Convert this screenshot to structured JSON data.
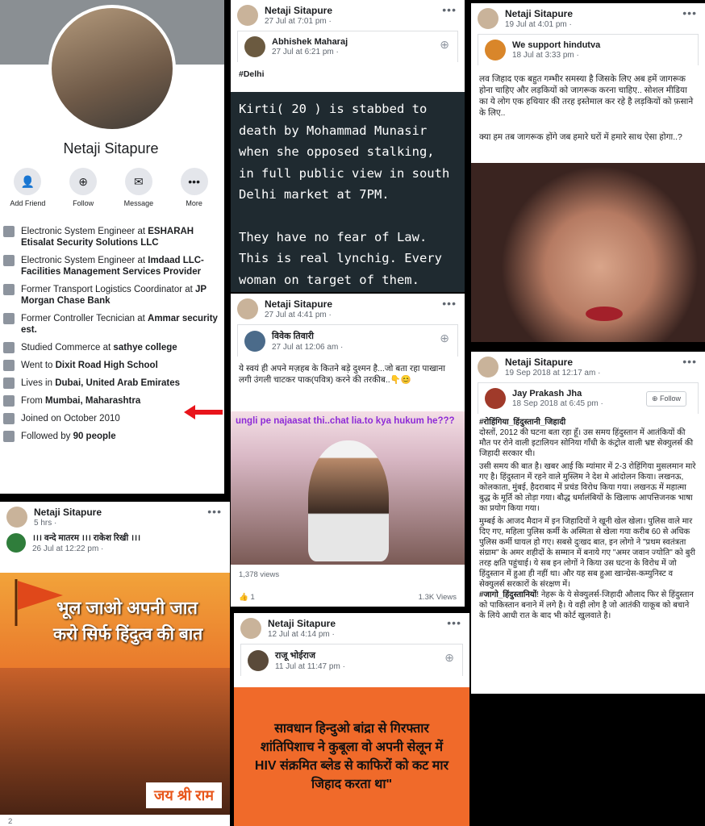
{
  "profile": {
    "name": "Netaji Sitapure",
    "actions": [
      {
        "icon": "add-friend-icon",
        "label": "Add Friend",
        "glyph": "👤"
      },
      {
        "icon": "follow-icon",
        "label": "Follow",
        "glyph": "⊕"
      },
      {
        "icon": "messenger-icon",
        "label": "Message",
        "glyph": "✉"
      },
      {
        "icon": "more-icon",
        "label": "More",
        "glyph": "•••"
      }
    ],
    "info": [
      {
        "prefix": "Electronic System Engineer at ",
        "bold": "ESHARAH Etisalat Security Solutions LLC"
      },
      {
        "prefix": "Electronic System Engineer at ",
        "bold": "Imdaad LLC-Facilities Management Services Provider"
      },
      {
        "prefix": "Former Transport Logistics Coordinator at ",
        "bold": "JP Morgan Chase Bank"
      },
      {
        "prefix": "Former Controller Tecnician at ",
        "bold": "Ammar security est."
      },
      {
        "prefix": "Studied Commerce at ",
        "bold": "sathye college"
      },
      {
        "prefix": "Went to ",
        "bold": "Dixit Road High School"
      },
      {
        "prefix": "Lives in ",
        "bold": "Dubai, United Arab Emirates"
      },
      {
        "prefix": "From ",
        "bold": "Mumbai, Maharashtra"
      },
      {
        "prefix": "Joined on October 2010",
        "bold": ""
      },
      {
        "prefix": "Followed by ",
        "bold": "90 people"
      }
    ]
  },
  "post_bottom_left": {
    "author": "Netaji Sitapure",
    "time": "5 hrs ·",
    "shared_author": "।।। वन्दे मातरम ।।। राकेश रिखी ।।।",
    "shared_time": "26 Jul at 12:22 pm ·",
    "image_line1": "भूल जाओ अपनी जात",
    "image_line2": "करो सिर्फ हिंदुत्व की बात",
    "image_badge": "जय श्री राम",
    "reactions": "2"
  },
  "post_mid_top": {
    "author": "Netaji Sitapure",
    "time": "27 Jul at 7:01 pm ·",
    "shared_author": "Abhishek Maharaj",
    "shared_time": "27 Jul at 6:21 pm ·",
    "hashtag": "#Delhi",
    "quote": "Kirti( 20 ) is stabbed to death by Mohammad Munasir when she opposed stalking, in full public view in south Delhi market at 7PM.",
    "quote2": "They have no fear of Law. This is real lynchig. Every woman on target of them."
  },
  "post_mid_video": {
    "author": "Netaji Sitapure",
    "time": "27 Jul at 4:41 pm ·",
    "shared_author": "विवेक तिवारी",
    "shared_time": "27 Jul at 12:06 am ·",
    "text": "ये स्वयं ही अपने मज़हब के कितने बड़े दुश्मन है...जो बता रहा पाखाना लगी उंगली चाटकर पाक(पवित्र) करने की तरकीब..👇😊",
    "video_caption": "ungli pe najaasat thi..chat lia.to kya hukum he???",
    "views_label": "1,378 views",
    "reactions": "1",
    "views_count": "1.3K Views"
  },
  "post_mid_bottom": {
    "author": "Netaji Sitapure",
    "time": "12 Jul at 4:14 pm ·",
    "shared_author": "राजू भोईराज",
    "shared_time": "11 Jul at 11:47 pm ·",
    "banner": "सावधान हिन्दुओ बांद्रा से गिरफ्तार शांतिपिशाच ने कुबूला वो अपनी सेलून में HIV संक्रमित ब्लेड से काफिरों को कट मार जिहाद करता था\""
  },
  "post_right_top": {
    "author": "Netaji Sitapure",
    "time": "19 Jul at 4:01 pm ·",
    "shared_author": "We support hindutva",
    "shared_time": "18 Jul at 3:33 pm ·",
    "text1": "लव जिहाद एक बहुत गम्भीर समस्या है जिसके लिए अब हमें जागरूक होना चाहिए और लड़कियों को जागरूक करना चाहिए.. सोशल मीडिया का ये लोग एक हथियार की तरह इस्तेमाल कर रहे है लड़कियों को फ़साने के लिए..",
    "text2": "क्या हम तब जागरूक होंगे जब हमारे घरों में हमारे साथ ऐसा होगा..?"
  },
  "post_right_bottom": {
    "author": "Netaji Sitapure",
    "time": "19 Sep 2018 at 12:17 am ·",
    "shared_author": "Jay Prakash Jha",
    "shared_time": "18 Sep 2018 at 6:45 pm ·",
    "follow_label": "Follow",
    "hashtag1": "#रोहिंगिया_हिंदुस्तानी_जिहादी",
    "para1": "दोस्तों, 2012 की घटना बता रहा हूँ। उस समय हिंदुस्तान में आतंकियों की मौत पर रोने वाली इटालियन सोनिया गाँधी के कंट्रोल वाली भ्रष्ट सेक्युलर्स की जिहादी सरकार थी।",
    "para2": "उसी समय की बात है। खबर आई कि म्यांमार में 2-3 रोहिंगिया मुसलमान मारे गए है। हिंदुस्तान में रहने वाले मुस्लिम ने देश मे आंदोलन किया। लखनऊ, कोलकाता, मुंबई, हैदराबाद में प्रचंड विरोध किया गया। लखनऊ में महात्मा बुद्ध के मूर्ति को तोड़ा गया। बौद्ध धर्मालंबियों के खिलाफ आपत्तिजनक भाषा का प्रयोग किया गया।",
    "para3": "मुम्बई के आजद मैदान में इन जिहादियों ने खूनी खेल खेला। पुलिस वाले मार दिए गए, महिला पुलिस कर्मी के अस्मिता से खेला गया करीब 60 से अधिक पुलिस कर्मी घायल हो गए। सबसे दुःखद बात, इन लोगो ने \"प्रथम स्वतंत्रता संग्राम\" के अमर शहीदों के  सम्मान में बनाये गए \"अमर जवान ज्योति\" को बुरी तरह क्षति पहुंचाई। ये सब इन लोगों ने किया उस घटना के विरोध में जो हिंदुस्तान में हुआ ही नहीं था। और यह सब हुआ खान्ग्रेस-कम्युनिस्ट व सेक्युलर्स सरकारों के संरक्षण में।",
    "hashtag2": "#जागो_हिंदुस्तानियों",
    "para4": "! नेहरू के ये सेक्युलर्स-जिहादी औलाद फिर से हिंदुस्तान को पाकिस्तान बनाने में लगे है। ये वही लोग है जो आतंकी याकूब को बचाने के लिये आधी रात के बाद भी कोर्ट खुलवाते है।"
  },
  "colors": {
    "arrow": "#e8141b",
    "banner_bg": "#f06a2a",
    "quote_bg": "#1f2a30",
    "video_caption": "#8e2bd6"
  }
}
